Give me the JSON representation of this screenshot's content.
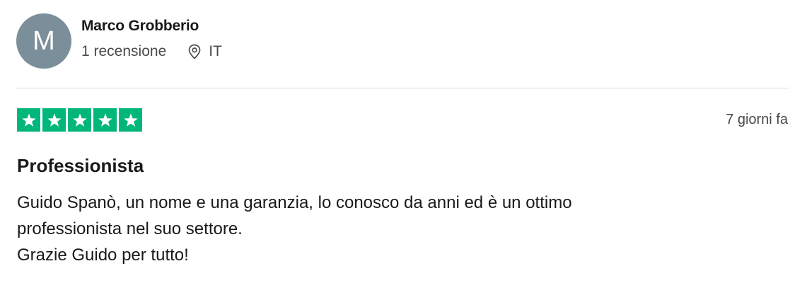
{
  "consumer": {
    "avatar_initial": "M",
    "name": "Marco Grobberio",
    "reviews_count": "1 recensione",
    "location": "IT"
  },
  "review": {
    "rating": 5,
    "rating_color": "#00b67a",
    "date": "7 giorni fa",
    "title": "Professionista",
    "body_lines": [
      "Guido Spanò, un nome e una garanzia, lo conosco da anni ed è un ottimo",
      "professionista nel suo settore.",
      "Grazie Guido per tutto!"
    ]
  },
  "icons": {
    "location": "location-pin-icon",
    "star": "star-icon"
  }
}
